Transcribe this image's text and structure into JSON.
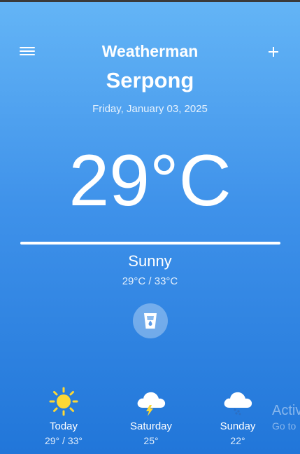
{
  "app_bar": {
    "title": "Weatherman",
    "menu_icon": "hamburger-menu-icon",
    "add_icon": "plus-icon"
  },
  "location": {
    "city": "Serpong",
    "date": "Friday, January 03, 2025"
  },
  "current": {
    "temperature": "29°C",
    "condition": "Sunny",
    "range": "29°C / 33°C"
  },
  "water_button": {
    "icon": "water-glass-icon"
  },
  "forecast": [
    {
      "day": "Today",
      "temps": "29° / 33°",
      "icon": "sun-icon"
    },
    {
      "day": "Saturday",
      "temps": "25°",
      "icon": "thunderstorm-cloud-icon"
    },
    {
      "day": "Sunday",
      "temps": "22°",
      "icon": "rain-cloud-icon"
    }
  ],
  "watermark": {
    "line1": "Activ",
    "line2": "Go to"
  },
  "colors": {
    "background_top": "#64b5f6",
    "background_bottom": "#2176d9",
    "sun": "#fdd835"
  }
}
